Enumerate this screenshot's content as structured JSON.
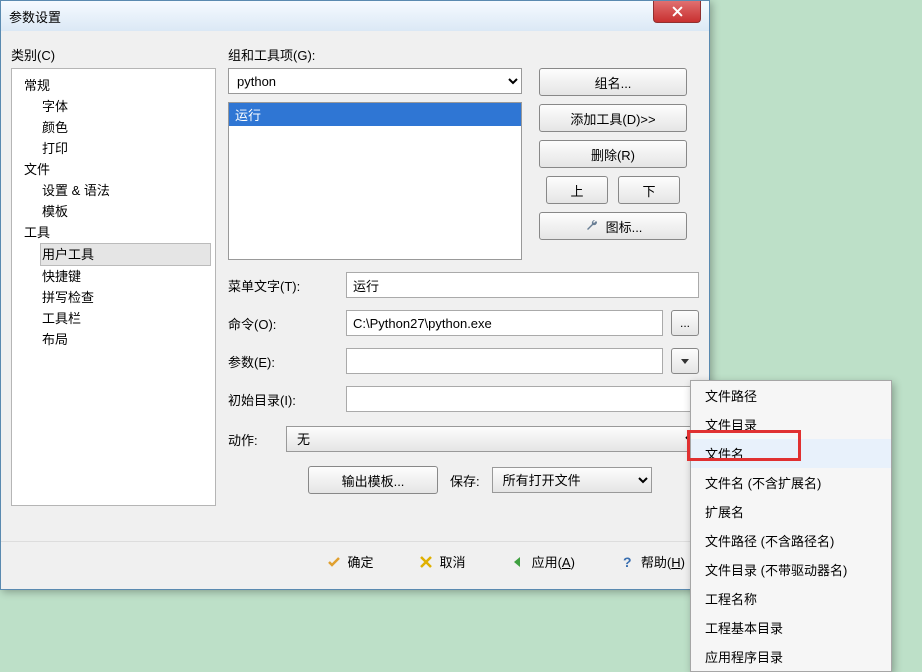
{
  "window": {
    "title": "参数设置"
  },
  "left": {
    "label": "类别(C)",
    "groups": [
      {
        "label": "常规",
        "children": [
          "字体",
          "颜色",
          "打印"
        ]
      },
      {
        "label": "文件",
        "children": [
          "设置 & 语法",
          "模板"
        ]
      },
      {
        "label": "工具",
        "children": [
          "用户工具",
          "快捷键",
          "拼写检查",
          "工具栏",
          "布局"
        ]
      }
    ],
    "selected": "用户工具"
  },
  "right": {
    "group_label": "组和工具项(G):",
    "group_value": "python",
    "items": [
      "运行"
    ],
    "buttons": {
      "group_name": "组名...",
      "add_tool": "添加工具(D)>>",
      "delete": "删除(R)",
      "up": "上",
      "down": "下",
      "icon": "图标..."
    },
    "form": {
      "menu_label": "菜单文字(T):",
      "menu_value": "运行",
      "cmd_label": "命令(O):",
      "cmd_value": "C:\\Python27\\python.exe",
      "arg_label": "参数(E):",
      "arg_value": "",
      "init_label": "初始目录(I):",
      "init_value": ""
    },
    "action_label": "动作:",
    "action_value": "无",
    "output_tmpl_btn": "输出模板...",
    "save_label": "保存:",
    "save_value": "所有打开文件"
  },
  "footer": {
    "ok": "确定",
    "cancel": "取消",
    "apply": "应用(A)",
    "help": "帮助(H)"
  },
  "popup": {
    "items": [
      "文件路径",
      "文件目录",
      "文件名",
      "文件名 (不含扩展名)",
      "扩展名",
      "文件路径 (不含路径名)",
      "文件目录 (不带驱动器名)",
      "工程名称",
      "工程基本目录",
      "应用程序目录"
    ],
    "highlight": "文件名"
  }
}
